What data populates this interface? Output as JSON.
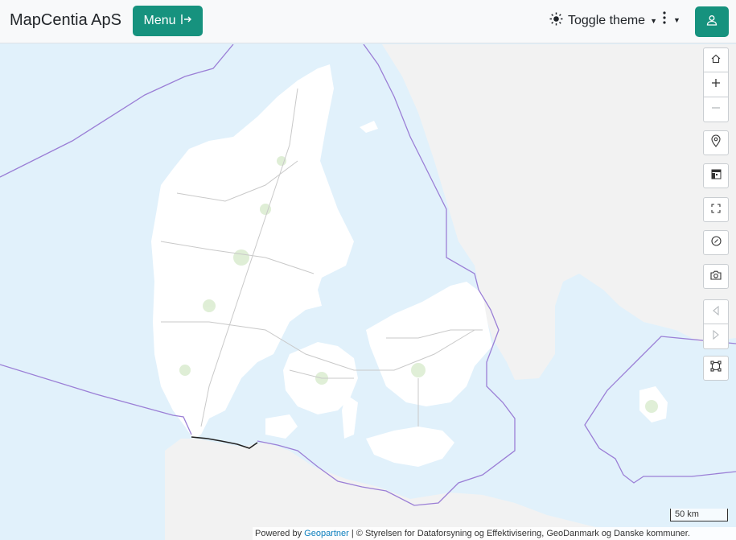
{
  "header": {
    "brand": "MapCentia ApS",
    "menu_label": "Menu",
    "theme_label": "Toggle theme"
  },
  "map_controls": [
    {
      "name": "home-button",
      "icon": "home-icon"
    },
    {
      "name": "zoom-in-button",
      "icon": "plus-icon"
    },
    {
      "name": "zoom-out-button",
      "icon": "minus-icon",
      "disabled": true
    },
    {
      "name": "locate-button",
      "icon": "location-pin-icon"
    },
    {
      "name": "baselayer-button",
      "icon": "layers-icon"
    },
    {
      "name": "fullscreen-button",
      "icon": "fullscreen-icon"
    },
    {
      "name": "clear-button",
      "icon": "circle-slash-icon"
    },
    {
      "name": "screenshot-button",
      "icon": "camera-icon"
    },
    {
      "name": "history-back-button",
      "icon": "triangle-left-icon",
      "disabled": true
    },
    {
      "name": "history-forward-button",
      "icon": "triangle-right-icon",
      "disabled": true
    },
    {
      "name": "extent-button",
      "icon": "box-select-icon"
    }
  ],
  "scale": {
    "label": "50 km"
  },
  "attribution": {
    "prefix": "Powered by",
    "link": "Geopartner",
    "text": " | © Styrelsen for Dataforsyning og Effektivisering, GeoDanmark og Danske kommuner."
  },
  "colors": {
    "accent": "#16927e",
    "sea": "#e1f1fb",
    "land": "#ffffff",
    "foreign_land": "#f2f2f2",
    "boundary": "#9b7fd6"
  }
}
